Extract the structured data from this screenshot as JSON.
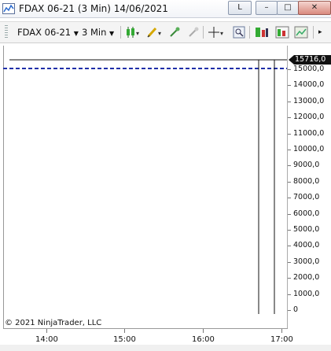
{
  "window": {
    "title": "FDAX 06-21 (3 Min)  14/06/2021",
    "btn_l": "L",
    "btn_min": "–",
    "btn_max": "□",
    "btn_close": "✕"
  },
  "toolbar": {
    "instrument": "FDAX 06-21",
    "interval": "3 Min",
    "icons": [
      "candlestick-icon",
      "pencil-icon",
      "crosshair-add-icon",
      "global-crosshair-icon",
      "crosshair-icon",
      "zoom-icon",
      "strategies-icon",
      "properties-icon"
    ]
  },
  "chart": {
    "last_price_label": "15716,0",
    "y_ticks": [
      "15000,0",
      "14000,0",
      "13000,0",
      "12000,0",
      "11000,0",
      "10000,0",
      "9000,0",
      "8000,0",
      "7000,0",
      "6000,0",
      "5000,0",
      "4000,0",
      "3000,0",
      "2000,0",
      "1000,0",
      "0"
    ],
    "x_ticks": [
      "14:00",
      "15:00",
      "16:00",
      "17:00"
    ],
    "copyright": "© 2021 NinjaTrader, LLC",
    "colors": {
      "price_line": "#111111",
      "dashed_line": "#1f2fa8",
      "tag_bg": "#111111"
    }
  }
}
